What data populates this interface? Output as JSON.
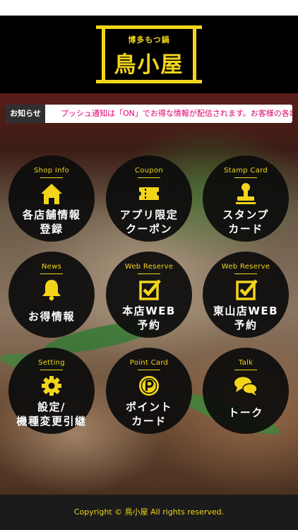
{
  "header": {
    "logo_subtitle": "博多もつ鍋",
    "logo_title": "鳥小屋"
  },
  "notice": {
    "label": "お知らせ",
    "text": "プッシュ通知は「ON」でお得な情報が配信されます。お客様の各端末の"
  },
  "menu": [
    {
      "en": "Shop Info",
      "jp1": "各店舗情報",
      "jp2": "登録",
      "icon": "house-icon"
    },
    {
      "en": "Coupon",
      "jp1": "アプリ限定",
      "jp2": "クーポン",
      "icon": "ticket-icon"
    },
    {
      "en": "Stamp Card",
      "jp1": "スタンプ",
      "jp2": "カード",
      "icon": "stamp-icon"
    },
    {
      "en": "News",
      "jp1": "お得情報",
      "jp2": "",
      "icon": "bell-icon"
    },
    {
      "en": "Web Reserve",
      "jp1": "本店WEB",
      "jp2": "予約",
      "icon": "checkbox-icon"
    },
    {
      "en": "Web Reserve",
      "jp1": "東山店WEB",
      "jp2": "予約",
      "icon": "checkbox-icon"
    },
    {
      "en": "Setting",
      "jp1": "設定/",
      "jp2": "機種変更引継",
      "icon": "gear-icon"
    },
    {
      "en": "Point Card",
      "jp1": "ポイント",
      "jp2": "カード",
      "icon": "coin-icon"
    },
    {
      "en": "Talk",
      "jp1": "トーク",
      "jp2": "",
      "icon": "chat-icon"
    }
  ],
  "footer": {
    "copyright": "Copyright © 鳥小屋 All rights reserved."
  },
  "colors": {
    "accent": "#f2d51a",
    "tile_bg": "#0c0c0c",
    "ticker_text": "#e0006e"
  }
}
